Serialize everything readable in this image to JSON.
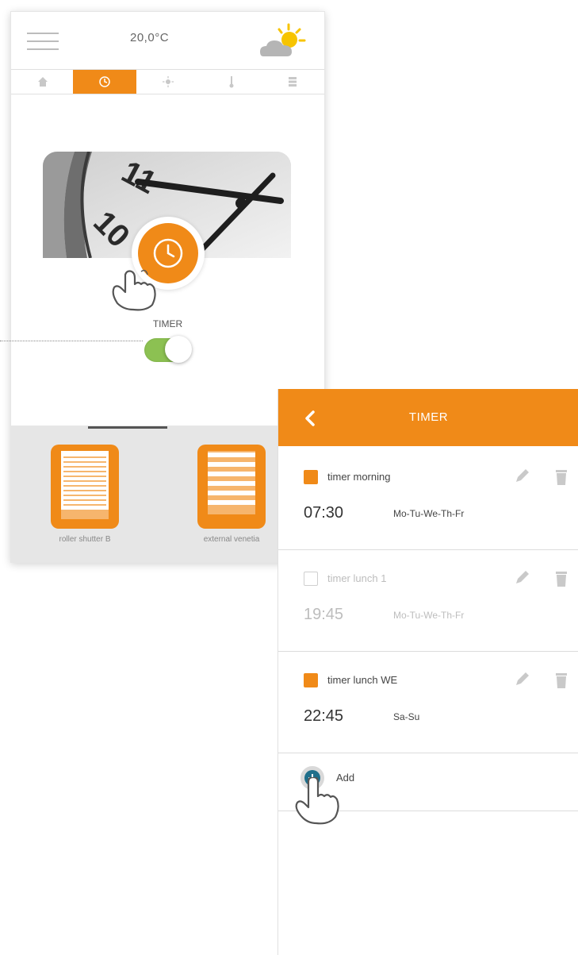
{
  "app": {
    "temperature": "20,0°C",
    "weather_icon": "partly-sunny-icon"
  },
  "tabs": [
    {
      "icon": "home-icon",
      "active": false
    },
    {
      "icon": "clock-icon",
      "active": true
    },
    {
      "icon": "sun-icon",
      "active": false
    },
    {
      "icon": "thermometer-icon",
      "active": false
    },
    {
      "icon": "grid-icon",
      "active": false
    }
  ],
  "timer_widget": {
    "label": "TIMER",
    "toggle_on": true
  },
  "devices": [
    {
      "label": "roller shutter B",
      "icon": "roller-shutter-icon"
    },
    {
      "label": "external venetia",
      "icon": "venetian-blind-icon"
    }
  ],
  "timer_panel": {
    "title": "TIMER",
    "timers": [
      {
        "name": "timer morning",
        "time": "07:30",
        "days": "Mo-Tu-We-Th-Fr",
        "enabled": true
      },
      {
        "name": "timer lunch 1",
        "time": "19:45",
        "days": "Mo-Tu-We-Th-Fr",
        "enabled": false
      },
      {
        "name": "timer lunch WE",
        "time": "22:45",
        "days": "Sa-Su",
        "enabled": true
      }
    ],
    "add_label": "Add"
  },
  "colors": {
    "accent": "#f08a18",
    "toggle_green": "#8cc152",
    "add_blue": "#1f6f8b"
  }
}
